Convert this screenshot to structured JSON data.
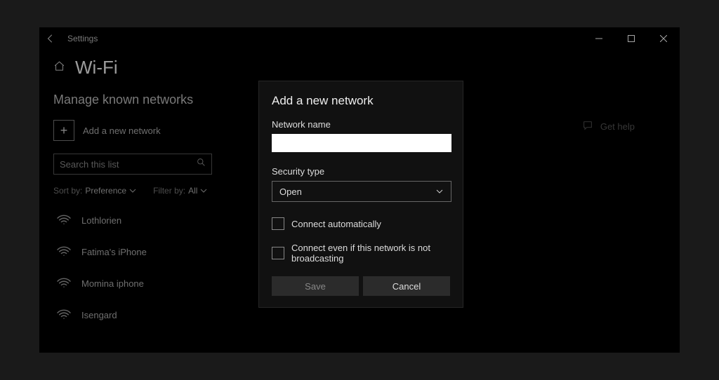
{
  "titlebar": {
    "app_name": "Settings"
  },
  "page": {
    "title": "Wi-Fi",
    "subheading": "Manage known networks",
    "add_network_label": "Add a new network",
    "search_placeholder": "Search this list",
    "sort_label": "Sort by:",
    "sort_value": "Preference",
    "filter_label": "Filter by:",
    "filter_value": "All"
  },
  "networks": [
    {
      "name": "Lothlorien"
    },
    {
      "name": "Fatima's iPhone"
    },
    {
      "name": "Momina iphone"
    },
    {
      "name": "Isengard"
    }
  ],
  "aside": {
    "get_help": "Get help"
  },
  "dialog": {
    "title": "Add a new network",
    "network_name_label": "Network name",
    "network_name_value": "",
    "security_type_label": "Security type",
    "security_type_value": "Open",
    "connect_auto_label": "Connect automatically",
    "connect_hidden_label": "Connect even if this network is not broadcasting",
    "save_label": "Save",
    "cancel_label": "Cancel"
  }
}
